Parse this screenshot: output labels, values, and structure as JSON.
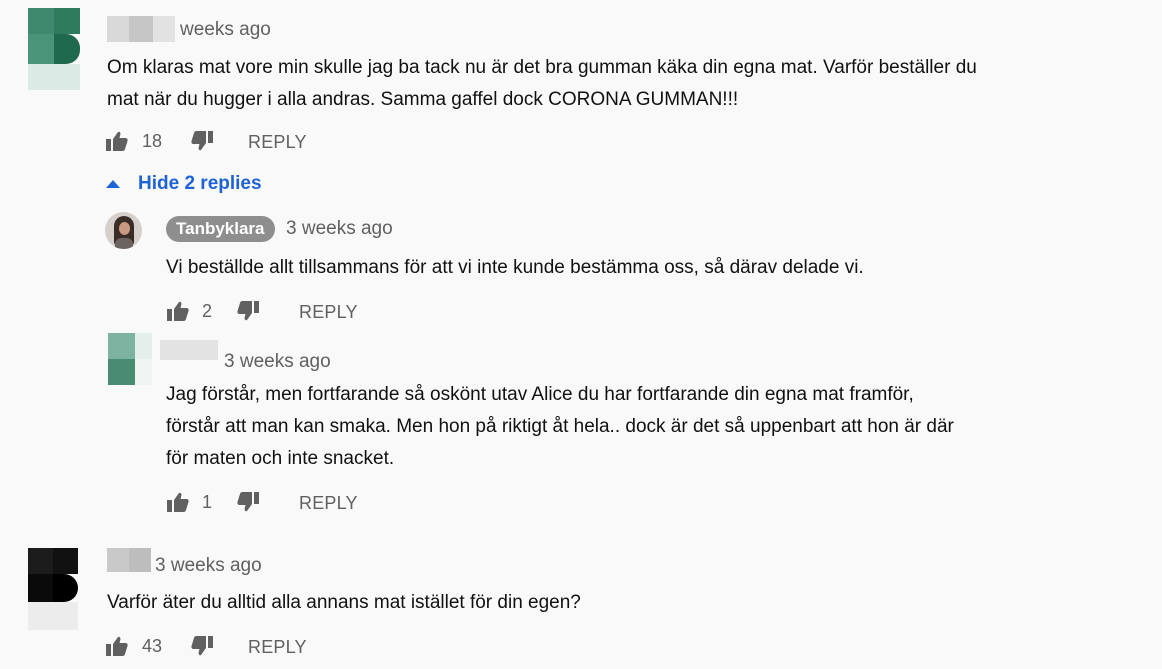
{
  "comments": [
    {
      "time": "weeks ago",
      "text_lines": [
        "Om klaras mat vore min skulle jag ba tack nu är det bra gumman käka din egna mat. Varför beställer du",
        "mat när du hugger i alla andras. Samma gaffel dock CORONA GUMMAN!!!"
      ],
      "likes": "18",
      "reply_label": "REPLY",
      "toggle_label": "Hide 2 replies",
      "replies": [
        {
          "author": "Tanbyklara",
          "time": "3 weeks ago",
          "text_lines": [
            "Vi beställde allt tillsammans för att vi inte kunde bestämma oss, så därav delade vi."
          ],
          "likes": "2",
          "reply_label": "REPLY"
        },
        {
          "time": "3 weeks ago",
          "text_lines": [
            "Jag förstår,  men fortfarande så oskönt utav Alice du har fortfarande din egna mat framför,",
            "förstår att man kan smaka. Men hon på riktigt åt hela.. dock är det så uppenbart att hon är där",
            "för maten och inte snacket."
          ],
          "likes": "1",
          "reply_label": "REPLY"
        }
      ]
    },
    {
      "time": "3 weeks ago",
      "text_lines": [
        "Varför äter du alltid alla annans mat istället för din egen?"
      ],
      "likes": "43",
      "reply_label": "REPLY"
    }
  ],
  "icons": {
    "like": "thumbs-up-icon",
    "dislike": "thumbs-down-icon",
    "caret": "caret-up-icon"
  },
  "colors": {
    "toggle": "#1e63d6",
    "meta": "#606060"
  }
}
